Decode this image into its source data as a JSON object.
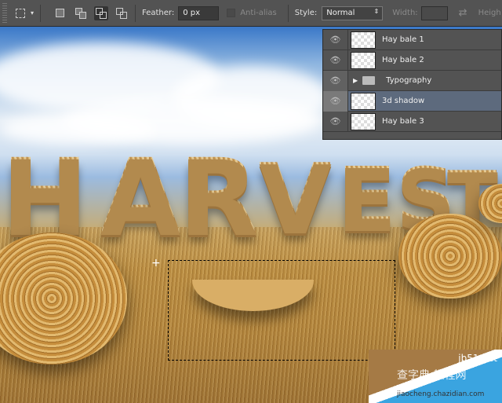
{
  "toolbar": {
    "feather_label": "Feather:",
    "feather_value": "0 px",
    "antialias_label": "Anti-alias",
    "style_label": "Style:",
    "style_value": "Normal",
    "width_label": "Width:",
    "height_label": "Heigh"
  },
  "canvas": {
    "headline": [
      "H",
      "A",
      "R",
      "V",
      "E",
      "S",
      "T"
    ]
  },
  "layers": [
    {
      "name": "Hay bale 1",
      "type": "layer",
      "tag": ""
    },
    {
      "name": "Hay bale 2",
      "type": "layer",
      "tag": ""
    },
    {
      "name": "Typography",
      "type": "group",
      "tag": "#c8454a"
    },
    {
      "name": "3d shadow",
      "type": "layer",
      "tag": "#5a8a3c",
      "selected": true
    },
    {
      "name": "Hay bale 3",
      "type": "layer",
      "tag": ""
    }
  ],
  "watermark": {
    "line1": "jb51.net",
    "line2": "查字典 教程网",
    "line3": "jiaocheng.chazidian.com"
  }
}
